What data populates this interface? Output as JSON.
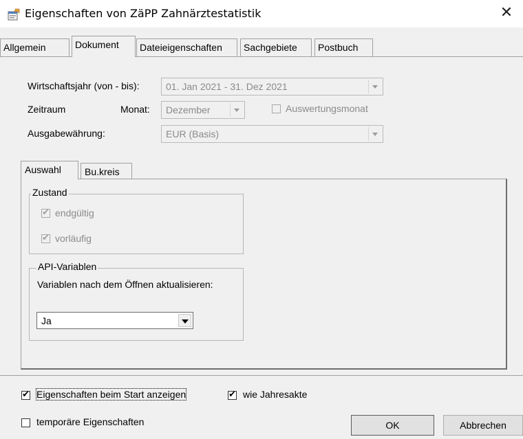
{
  "window": {
    "title": "Eigenschaften von ZäPP Zahnärztestatistik",
    "close_glyph": "✕"
  },
  "tabs": [
    {
      "label": "Allgemein"
    },
    {
      "label": "Dokument"
    },
    {
      "label": "Dateieigenschaften"
    },
    {
      "label": "Sachgebiete"
    },
    {
      "label": "Postbuch"
    }
  ],
  "active_tab": "Dokument",
  "document": {
    "fiscal_year_label": "Wirtschaftsjahr (von - bis):",
    "fiscal_year_value": "01. Jan 2021  -  31. Dez 2021",
    "period_label": "Zeitraum",
    "month_label": "Monat:",
    "month_value": "Dezember",
    "evaluation_month_label": "Auswertungsmonat",
    "currency_label": "Ausgabewährung:",
    "currency_value": "EUR (Basis)"
  },
  "inner_tabs": [
    {
      "label": "Auswahl"
    },
    {
      "label": "Bu.kreis"
    }
  ],
  "state_group": {
    "title": "Zustand",
    "final_label": "endgültig",
    "preliminary_label": "vorläufig"
  },
  "api_group": {
    "title": "API-Variablen",
    "description": "Variablen nach dem Öffnen aktualisieren:",
    "selected": "Ja"
  },
  "footer": {
    "show_on_start_label": "Eigenschaften beim Start anzeigen",
    "like_annual_label": "wie Jahresakte",
    "temporary_label": "temporäre Eigenschaften",
    "ok_label": "OK",
    "cancel_label": "Abbrechen",
    "check_glyph": "✔"
  }
}
